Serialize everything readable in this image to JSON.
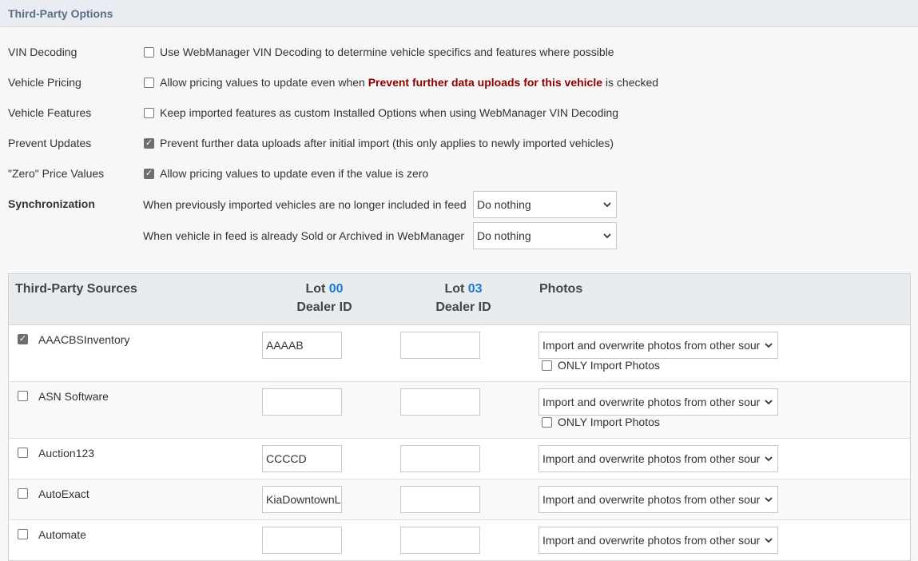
{
  "header": {
    "title": "Third-Party Options"
  },
  "options": [
    {
      "label": "VIN Decoding",
      "checked": false,
      "text": "Use WebManager VIN Decoding to determine vehicle specifics and features where possible"
    },
    {
      "label": "Vehicle Pricing",
      "checked": false,
      "text_before": "Allow pricing values to update even when ",
      "text_bold": "Prevent further data uploads for this vehicle",
      "text_after": " is checked"
    },
    {
      "label": "Vehicle Features",
      "checked": false,
      "text": "Keep imported features as custom Installed Options when using WebManager VIN Decoding"
    },
    {
      "label": "Prevent Updates",
      "checked": true,
      "text": "Prevent further data uploads after initial import (this only applies to newly imported vehicles)"
    },
    {
      "label": "\"Zero\" Price Values",
      "checked": true,
      "text": "Allow pricing values to update even if the value is zero"
    }
  ],
  "sync": {
    "label": "Synchronization",
    "rows": [
      {
        "text": "When previously imported vehicles are no longer included in feed",
        "selected": "Do nothing"
      },
      {
        "text": "When vehicle in feed is already Sold or Archived in WebManager",
        "selected": "Do nothing"
      }
    ]
  },
  "table": {
    "col_sources": "Third-Party Sources",
    "lot_word": "Lot",
    "lots": [
      "00",
      "03"
    ],
    "dealer_id": "Dealer ID",
    "col_photos": "Photos",
    "only_import_label": "ONLY Import Photos",
    "photo_option": "Import and overwrite photos from other sour",
    "rows": [
      {
        "name": "AAACBSInventory",
        "checked": true,
        "lot00": "AAAAB",
        "lot03": ""
      },
      {
        "name": "ASN Software",
        "checked": false,
        "lot00": "",
        "lot03": ""
      },
      {
        "name": "Auction123",
        "checked": false,
        "lot00": "CCCCD",
        "lot03": ""
      },
      {
        "name": "AutoExact",
        "checked": false,
        "lot00": "KiaDowntownL",
        "lot03": ""
      },
      {
        "name": "Automate",
        "checked": false,
        "lot00": "",
        "lot03": ""
      }
    ]
  },
  "colors": {
    "accent": "#1a7ad4",
    "warning": "#8b0000",
    "header_text": "#5a6f87"
  }
}
